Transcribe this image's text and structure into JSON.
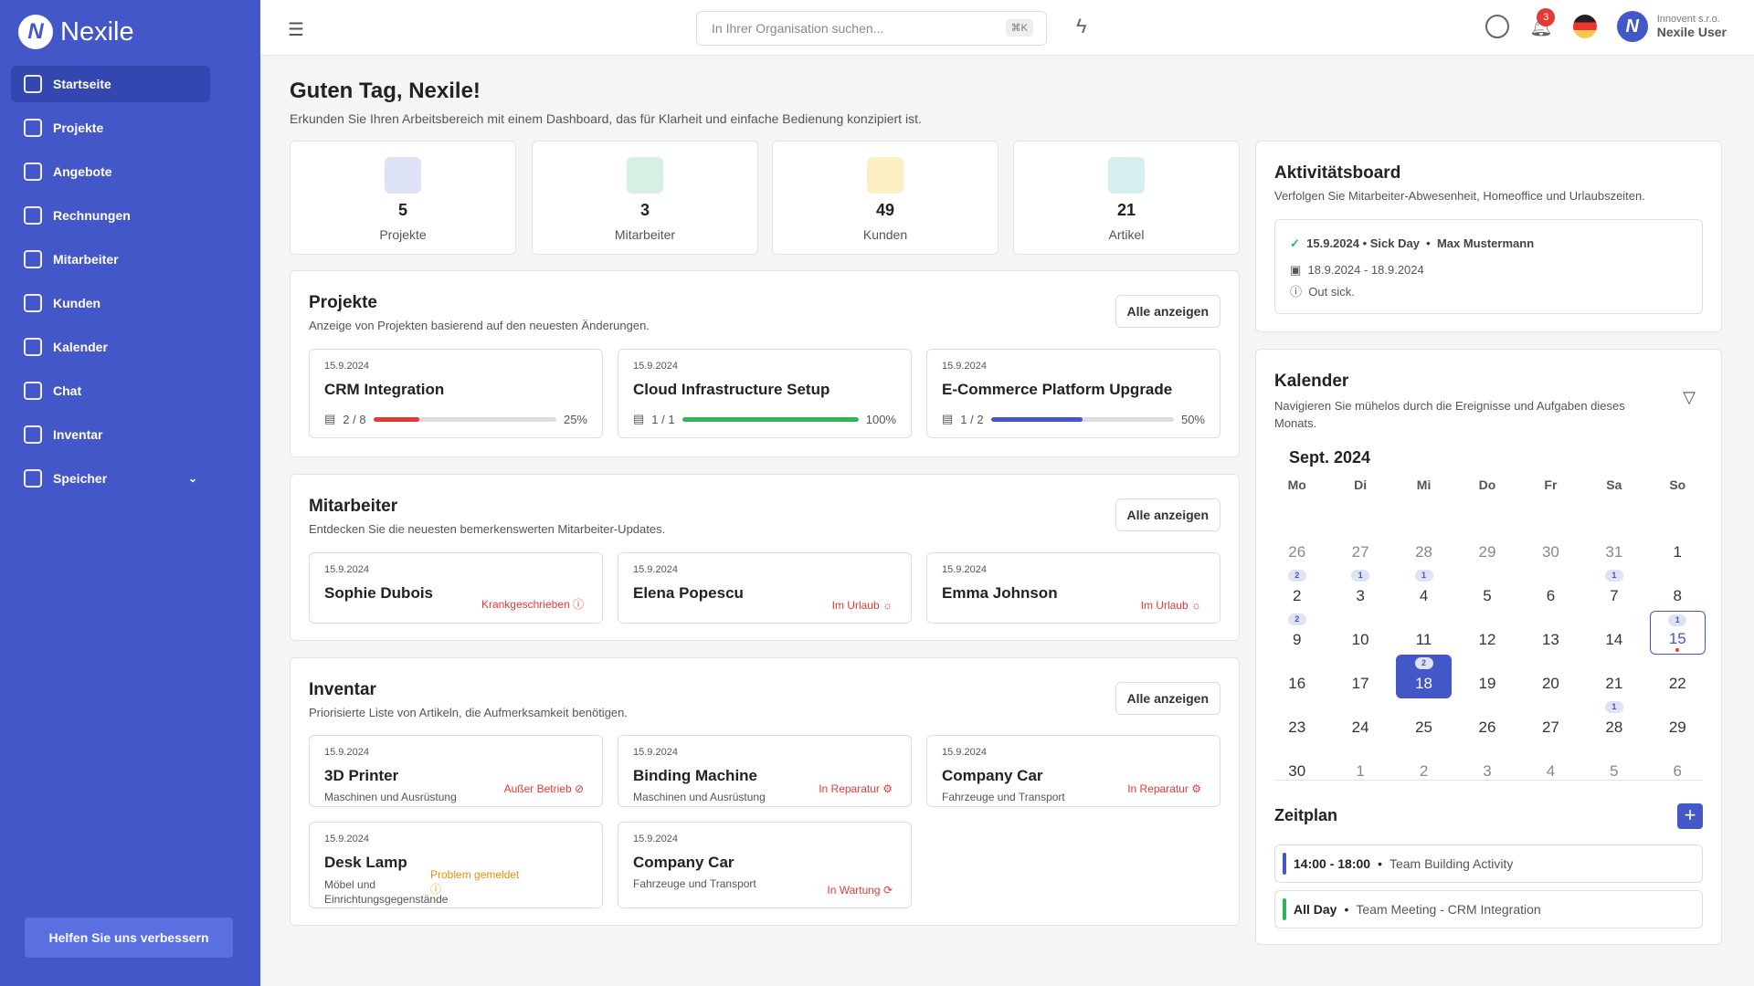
{
  "brand": "Nexile",
  "sidebar": {
    "items": [
      {
        "label": "Startseite"
      },
      {
        "label": "Projekte"
      },
      {
        "label": "Angebote"
      },
      {
        "label": "Rechnungen"
      },
      {
        "label": "Mitarbeiter"
      },
      {
        "label": "Kunden"
      },
      {
        "label": "Kalender"
      },
      {
        "label": "Chat"
      },
      {
        "label": "Inventar"
      },
      {
        "label": "Speicher"
      }
    ],
    "help": "Helfen Sie uns verbessern"
  },
  "header": {
    "search_placeholder": "In Ihrer Organisation suchen...",
    "shortcut": "⌘K",
    "notifications": "3",
    "org": "Innovent s.r.o.",
    "user": "Nexile User"
  },
  "greeting": {
    "title": "Guten Tag, Nexile!",
    "subtitle": "Erkunden Sie Ihren Arbeitsbereich mit einem Dashboard, das für Klarheit und einfache Bedienung konzipiert ist."
  },
  "stats": [
    {
      "value": "5",
      "label": "Projekte",
      "color": "#dde2f5"
    },
    {
      "value": "3",
      "label": "Mitarbeiter",
      "color": "#d8f0e4"
    },
    {
      "value": "49",
      "label": "Kunden",
      "color": "#fcefc4"
    },
    {
      "value": "21",
      "label": "Artikel",
      "color": "#d6f0f0"
    }
  ],
  "projects": {
    "title": "Projekte",
    "subtitle": "Anzeige von Projekten basierend auf den neuesten Änderungen.",
    "all": "Alle anzeigen",
    "items": [
      {
        "date": "15.9.2024",
        "name": "CRM Integration",
        "tasks": "2 / 8",
        "percent": 25,
        "percent_label": "25%",
        "color": "#e53935"
      },
      {
        "date": "15.9.2024",
        "name": "Cloud Infrastructure Setup",
        "tasks": "1 / 1",
        "percent": 100,
        "percent_label": "100%",
        "color": "#2fb45a"
      },
      {
        "date": "15.9.2024",
        "name": "E-Commerce Platform Upgrade",
        "tasks": "1 / 2",
        "percent": 50,
        "percent_label": "50%",
        "color": "#4357c8"
      }
    ]
  },
  "employees": {
    "title": "Mitarbeiter",
    "subtitle": "Entdecken Sie die neuesten bemerkenswerten Mitarbeiter-Updates.",
    "all": "Alle anzeigen",
    "items": [
      {
        "date": "15.9.2024",
        "name": "Sophie Dubois",
        "status": "Krankgeschrieben ⓘ"
      },
      {
        "date": "15.9.2024",
        "name": "Elena Popescu",
        "status": "Im Urlaub ☼"
      },
      {
        "date": "15.9.2024",
        "name": "Emma Johnson",
        "status": "Im Urlaub ☼"
      }
    ]
  },
  "inventory": {
    "title": "Inventar",
    "subtitle": "Priorisierte Liste von Artikeln, die Aufmerksamkeit benötigen.",
    "all": "Alle anzeigen",
    "items": [
      {
        "date": "15.9.2024",
        "name": "3D Printer",
        "category": "Maschinen und Ausrüstung",
        "status": "Außer Betrieb ⊘",
        "color": "#e53935"
      },
      {
        "date": "15.9.2024",
        "name": "Binding Machine",
        "category": "Maschinen und Ausrüstung",
        "status": "In Reparatur ⚙",
        "color": "#e53935"
      },
      {
        "date": "15.9.2024",
        "name": "Company Car",
        "category": "Fahrzeuge und Transport",
        "status": "In Reparatur ⚙",
        "color": "#e53935"
      },
      {
        "date": "15.9.2024",
        "name": "Desk Lamp",
        "category": "Möbel und Einrichtungsgegenstände",
        "status": "Problem gemeldet ⓘ",
        "color": "#e8900c"
      },
      {
        "date": "15.9.2024",
        "name": "Company Car",
        "category": "Fahrzeuge und Transport",
        "status": "In Wartung ⟳",
        "color": "#e53935"
      }
    ]
  },
  "activity": {
    "title": "Aktivitätsboard",
    "subtitle": "Verfolgen Sie Mitarbeiter-Abwesenheit, Homeoffice und Urlaubszeiten.",
    "entry": {
      "headline": "15.9.2024 • Sick Day",
      "person": "Max Mustermann",
      "range": "18.9.2024 - 18.9.2024",
      "note": "Out sick."
    }
  },
  "calendar": {
    "title": "Kalender",
    "subtitle": "Navigieren Sie mühelos durch die Ereignisse und Aufgaben dieses Monats.",
    "month": "Sept. 2024",
    "weekdays": [
      "Mo",
      "Di",
      "Mi",
      "Do",
      "Fr",
      "Sa",
      "So"
    ],
    "days": [
      [
        "26",
        0,
        1
      ],
      [
        "27",
        0,
        1
      ],
      [
        "28",
        0,
        1
      ],
      [
        "29",
        0,
        1
      ],
      [
        "30",
        0,
        1
      ],
      [
        "31",
        0,
        1
      ],
      [
        "1",
        0,
        0
      ],
      [
        "2",
        2,
        0
      ],
      [
        "3",
        1,
        0
      ],
      [
        "4",
        1,
        0
      ],
      [
        "5",
        0,
        0
      ],
      [
        "6",
        0,
        0
      ],
      [
        "7",
        1,
        0
      ],
      [
        "8",
        0,
        0
      ],
      [
        "9",
        2,
        0
      ],
      [
        "10",
        0,
        0
      ],
      [
        "11",
        0,
        0
      ],
      [
        "12",
        0,
        0
      ],
      [
        "13",
        0,
        0
      ],
      [
        "14",
        0,
        0
      ],
      [
        "15",
        1,
        0
      ],
      [
        "16",
        0,
        0
      ],
      [
        "17",
        0,
        0
      ],
      [
        "18",
        2,
        0
      ],
      [
        "19",
        0,
        0
      ],
      [
        "20",
        0,
        0
      ],
      [
        "21",
        0,
        0
      ],
      [
        "22",
        0,
        0
      ],
      [
        "23",
        0,
        0
      ],
      [
        "24",
        0,
        0
      ],
      [
        "25",
        0,
        0
      ],
      [
        "26",
        0,
        0
      ],
      [
        "27",
        0,
        0
      ],
      [
        "28",
        1,
        0
      ],
      [
        "29",
        0,
        0
      ],
      [
        "30",
        0,
        0
      ],
      [
        "1",
        0,
        1
      ],
      [
        "2",
        0,
        1
      ],
      [
        "3",
        0,
        1
      ],
      [
        "4",
        0,
        1
      ],
      [
        "5",
        0,
        1
      ],
      [
        "6",
        0,
        1
      ]
    ],
    "selected": "18",
    "today": "15"
  },
  "schedule": {
    "title": "Zeitplan",
    "add": "+",
    "items": [
      {
        "time": "14:00 - 18:00",
        "event": "Team Building Activity",
        "color": "#4357c8"
      },
      {
        "time": "All Day",
        "event": "Team Meeting - CRM Integration",
        "color": "#2fb45a"
      }
    ]
  }
}
